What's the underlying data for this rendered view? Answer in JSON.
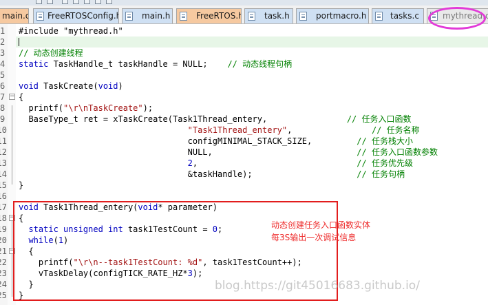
{
  "tabs": [
    {
      "label": "main.c",
      "style": "orange"
    },
    {
      "label": "FreeRTOSConfig.h",
      "style": "blue"
    },
    {
      "label": "main.h",
      "style": "blue"
    },
    {
      "label": "FreeRTOS.h",
      "style": "orange"
    },
    {
      "label": "task.h",
      "style": "blue"
    },
    {
      "label": "portmacro.h",
      "style": "blue"
    },
    {
      "label": "tasks.c",
      "style": "blue"
    },
    {
      "label": "mythread.c",
      "style": "active"
    }
  ],
  "code": {
    "l1": {
      "num": "1",
      "a": "#include \"mythread.h\""
    },
    "l3": {
      "num": "3",
      "cm": "// 动态创建线程"
    },
    "l4": {
      "num": "4",
      "kw": "static",
      "a": " TaskHandle_t taskHandle = NULL;    ",
      "cm": "// 动态线程句柄"
    },
    "l6": {
      "num": "6",
      "kw": "void",
      "a": " TaskCreate(",
      "kw2": "void",
      "b": ")"
    },
    "l7": {
      "num": "7",
      "a": "{"
    },
    "l8": {
      "num": "8",
      "a": "  printf(",
      "st": "\"\\r\\nTaskCreate\"",
      "b": ");"
    },
    "l9": {
      "num": "9",
      "a": "  BaseType_t ret = xTaskCreate(Task1Thread_entery,                ",
      "cm": "// 任务入口函数"
    },
    "l10": {
      "num": "10",
      "pad": "                                  ",
      "st": "\"Task1Thread_entery\"",
      "a": ",                ",
      "cm": "// 任务名称"
    },
    "l11": {
      "num": "11",
      "a": "                                  configMINIMAL_STACK_SIZE,         ",
      "cm": "// 任务栈大小"
    },
    "l12": {
      "num": "12",
      "a": "                                  NULL,                             ",
      "cm": "// 任务入口函数参数"
    },
    "l13": {
      "num": "13",
      "pad": "                                  ",
      "nm": "2",
      "a": ",                                ",
      "cm": "// 任务优先级"
    },
    "l14": {
      "num": "14",
      "a": "                                  &taskHandle);                     ",
      "cm": "// 任务句柄"
    },
    "l15": {
      "num": "15",
      "a": "}"
    },
    "l17": {
      "num": "17",
      "kw": "void",
      "a": " Task1Thread_entery(",
      "kw2": "void",
      "b": "* parameter)"
    },
    "l18": {
      "num": "18",
      "a": "{"
    },
    "l19": {
      "num": "19",
      "pad": "  ",
      "kw": "static unsigned int",
      "a": " task1TestCount = ",
      "nm": "0",
      "b": ";"
    },
    "l20": {
      "num": "20",
      "pad": "  ",
      "kw": "while",
      "a": "(",
      "nm": "1",
      "b": ")"
    },
    "l21": {
      "num": "21",
      "a": "  {"
    },
    "l22": {
      "num": "22",
      "a": "    printf(",
      "st": "\"\\r\\n--task1TestCount: %d\"",
      "b": ", task1TestCount++);"
    },
    "l23": {
      "num": "23",
      "a": "    vTaskDelay(configTICK_RATE_HZ*",
      "nm": "3",
      "b": ");"
    },
    "l24": {
      "num": "24",
      "a": "  }"
    },
    "l25": {
      "num": "25",
      "a": "}"
    }
  },
  "annotation": {
    "line1": "动态创建任务入口函数实体",
    "line2": "每3S输出一次调试信息"
  },
  "watermark": "blog.https://git45016683.github.io/",
  "colors": {
    "annotation": "#ee2b2b",
    "highlight_box": "#e21d1d",
    "tab_circle": "#e23ad8"
  }
}
